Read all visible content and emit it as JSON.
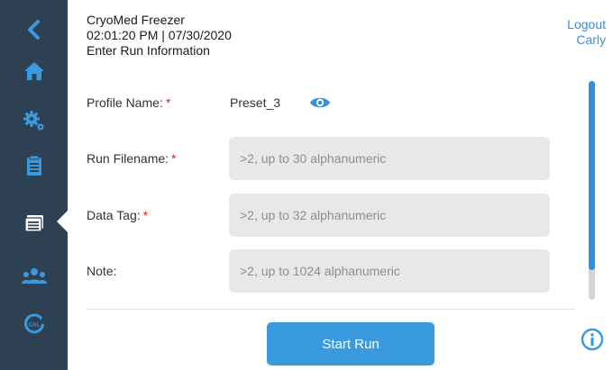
{
  "header": {
    "app_title": "CryoMed Freezer",
    "datetime": "02:01:20 PM | 07/30/2020",
    "page_title": "Enter Run Information"
  },
  "user": {
    "logout_label": "Logout",
    "username": "Carly"
  },
  "sidebar": {
    "items": [
      {
        "icon": "chevron-left-icon",
        "active": false
      },
      {
        "icon": "home-icon",
        "active": false
      },
      {
        "icon": "gears-icon",
        "active": false
      },
      {
        "icon": "clipboard-icon",
        "active": false
      },
      {
        "icon": "run-list-icon",
        "active": true
      },
      {
        "icon": "users-icon",
        "active": false
      },
      {
        "icon": "calibration-icon",
        "active": false
      }
    ]
  },
  "form": {
    "required_marker": "*",
    "profile_name": {
      "label": "Profile Name:",
      "value": "Preset_3"
    },
    "run_filename": {
      "label": "Run Filename:",
      "placeholder": ">2, up to 30 alphanumeric"
    },
    "data_tag": {
      "label": "Data Tag:",
      "placeholder": ">2, up to 32 alphanumeric"
    },
    "note": {
      "label": "Note:",
      "placeholder": ">2, up to 1024 alphanumeric"
    }
  },
  "actions": {
    "start_run_label": "Start Run"
  },
  "colors": {
    "sidebar_bg": "#2e4152",
    "accent": "#3a9ae0",
    "required": "#e02424",
    "field_bg": "#e8e8e8"
  }
}
